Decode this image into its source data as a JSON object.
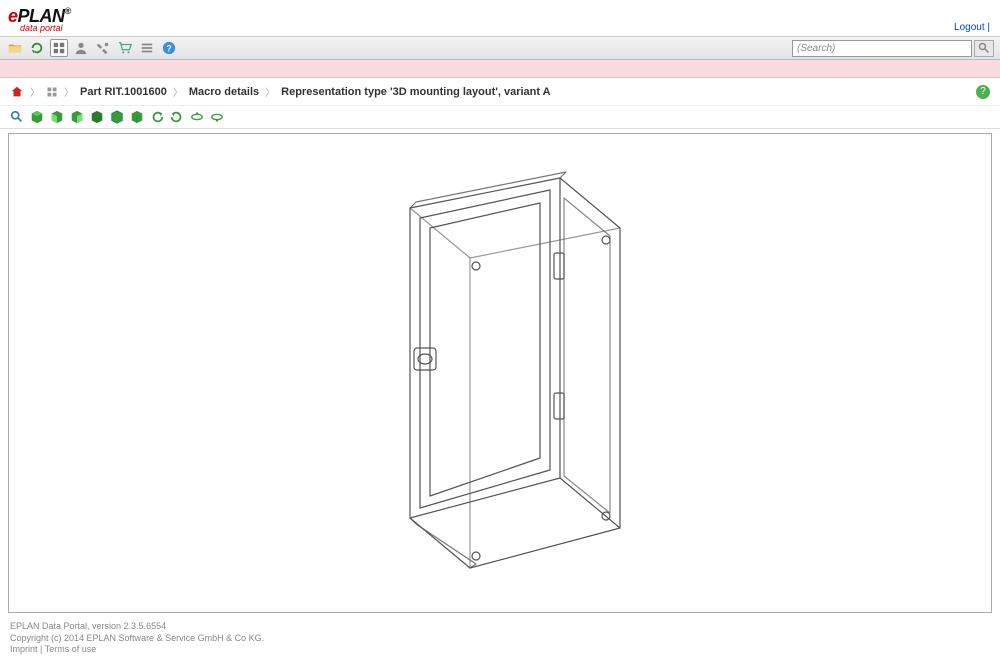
{
  "logo": {
    "prefix": "e",
    "main": "PLAN",
    "sub": "data portal",
    "reg": "®"
  },
  "topLinks": {
    "logout": "Logout",
    "sep": "|"
  },
  "search": {
    "placeholder": "(Search)"
  },
  "breadcrumb": {
    "part": "Part RIT.1001600",
    "macro": "Macro details",
    "rep": "Representation type '3D mounting layout', variant A"
  },
  "footer": {
    "line1": "EPLAN Data Portal, version 2.3.5.6554",
    "line2": "Copyright (c) 2014 EPLAN Software & Service GmbH & Co KG.",
    "imprint": "Imprint",
    "terms": "Terms of use",
    "sep": " | "
  }
}
